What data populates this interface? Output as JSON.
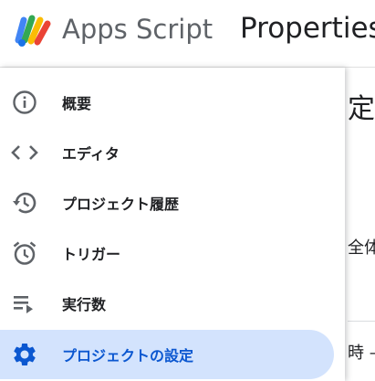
{
  "header": {
    "app_name": "Apps Script",
    "project_title": "Properties"
  },
  "background": {
    "heading": "定",
    "text1": "全体",
    "text2": "時 –"
  },
  "nav": {
    "items": [
      {
        "label": "概要",
        "icon": "info-icon"
      },
      {
        "label": "エディタ",
        "icon": "code-icon"
      },
      {
        "label": "プロジェクト履歴",
        "icon": "history-icon"
      },
      {
        "label": "トリガー",
        "icon": "alarm-clock-icon"
      },
      {
        "label": "実行数",
        "icon": "executions-list-icon"
      },
      {
        "label": "プロジェクトの設定",
        "icon": "gear-icon",
        "active": true
      }
    ]
  },
  "colors": {
    "accent": "#0b57d0",
    "active_bg": "#d3e3fd",
    "icon": "#5f6368"
  }
}
